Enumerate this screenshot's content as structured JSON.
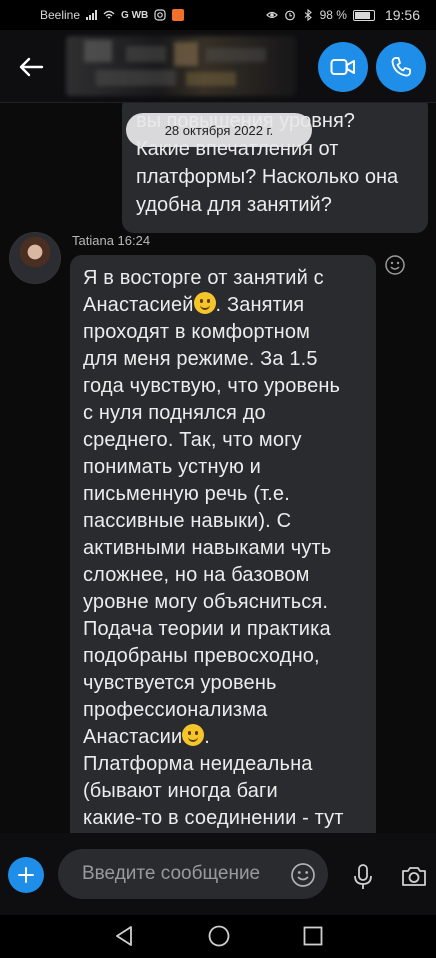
{
  "status_bar": {
    "carrier": "Beeline",
    "network_badges": "G WB",
    "battery": "98 %",
    "time": "19:56"
  },
  "header": {
    "contact_name_hidden": true
  },
  "chat": {
    "outgoing_message": {
      "lines": [
        "вы повышения уровня?",
        "Какие впечатления от",
        "платформы? Насколько она",
        "удобна для занятий?"
      ]
    },
    "date_separator": "28 октября 2022 г.",
    "incoming_message": {
      "sender": "Tatiana",
      "time": "16:24",
      "lines": [
        "Я в восторге от занятий с",
        "Анастасией",
        ". Занятия",
        "проходят в комфортном",
        "для меня режиме. За 1.5",
        "года чувствую, что уровень",
        "с нуля поднялся до",
        "среднего. Так, что могу",
        "понимать устную и",
        "письменную речь (т.е.",
        "пассивные навыки). С",
        "активными навыками чуть",
        "сложнее, но на базовом",
        "уровне могу объясниться.",
        "Подача теории и практика",
        "подобраны превосходно,",
        "чувствуется уровень",
        "профессионализма",
        "Анастасии",
        ".",
        "Платформа неидеальна",
        "(бывают иногда баги",
        "какие-то в соединении - тут"
      ]
    }
  },
  "composer": {
    "placeholder": "Введите сообщение"
  },
  "colors": {
    "accent": "#1e8ee8",
    "bubble": "#2a2b2f",
    "background": "#0b0b0c"
  },
  "icons": [
    "back-arrow-icon",
    "video-call-icon",
    "phone-icon",
    "add-reaction-icon",
    "plus-icon",
    "emoji-icon",
    "microphone-icon",
    "camera-icon",
    "nav-back-icon",
    "nav-home-icon",
    "nav-recents-icon"
  ]
}
